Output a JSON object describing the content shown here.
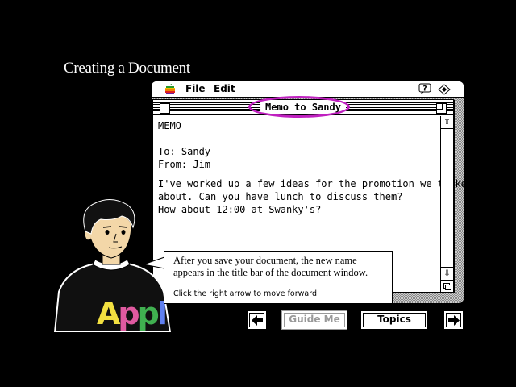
{
  "lesson": {
    "title": "Creating a Document"
  },
  "menubar": {
    "apple_icon": "apple-icon",
    "menus": [
      "File",
      "Edit"
    ],
    "help_icon": "balloon-help-icon",
    "app_icon": "application-icon"
  },
  "document": {
    "window_title": "Memo to Sandy",
    "lines": [
      "MEMO",
      "",
      "To:  Sandy",
      "From:  Jim",
      "",
      "I've worked up a few ideas for the promotion we talked",
      "about.  Can you have lunch to discuss them?",
      "How about 12:00 at Swanky's?"
    ]
  },
  "bubble": {
    "message": "After you save your document, the new name appears in the title bar of the document window.",
    "hint": "Click the right arrow to move forward."
  },
  "guide": {
    "shirt_text": "Appl"
  },
  "nav": {
    "back_icon": "left-arrow-icon",
    "guide_me": "Guide Me",
    "topics": "Topics",
    "forward_icon": "right-arrow-icon"
  },
  "colors": {
    "highlight": "#c020c0",
    "background": "#000000"
  }
}
